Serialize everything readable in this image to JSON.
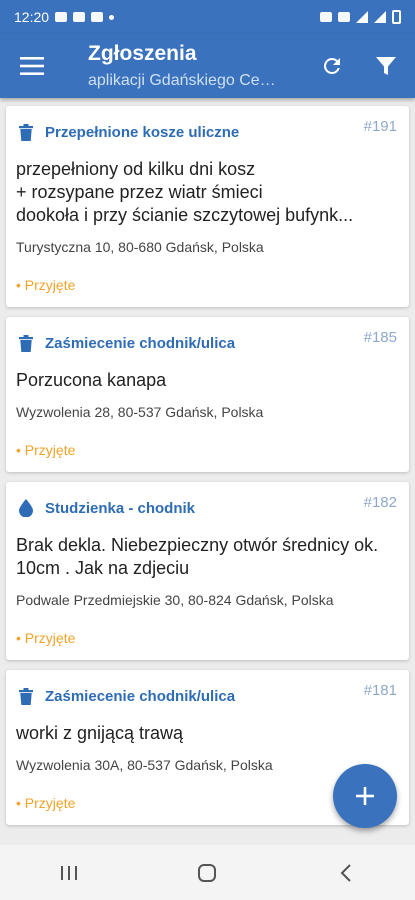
{
  "status_bar": {
    "time": "12:20"
  },
  "app_bar": {
    "title": "Zgłoszenia",
    "subtitle": "aplikacji Gdańskiego Centrum Kontaktu",
    "icons": {
      "menu": "menu-icon",
      "refresh": "refresh-icon",
      "filter": "filter-icon"
    }
  },
  "reports": [
    {
      "category": "Przepełnione kosze uliczne",
      "category_icon": "trash-icon",
      "number": "#191",
      "description": "przepełniony od  kilku dni kosz\n+ rozsypane przez wiatr śmieci\ndookoła i przy ścianie szczytowej bufynk...",
      "address": "Turystyczna 10, 80-680 Gdańsk, Polska",
      "status": "• Przyjęte"
    },
    {
      "category": "Zaśmiecenie chodnik/ulica",
      "category_icon": "trash-icon",
      "number": "#185",
      "description": "Porzucona kanapa",
      "address": "Wyzwolenia 28, 80-537 Gdańsk, Polska",
      "status": "• Przyjęte"
    },
    {
      "category": "Studzienka - chodnik",
      "category_icon": "water-drop-icon",
      "number": "#182",
      "description": "Brak dekla. Niebezpieczny otwór średnicy ok. 10cm . Jak na zdjeciu",
      "address": "Podwale Przedmiejskie 30, 80-824 Gdańsk, Polska",
      "status": "• Przyjęte"
    },
    {
      "category": "Zaśmiecenie chodnik/ulica",
      "category_icon": "trash-icon",
      "number": "#181",
      "description": "worki z gnijącą trawą",
      "address": "Wyzwolenia 30A, 80-537 Gdańsk, Polska",
      "status": "• Przyjęte"
    }
  ],
  "fab": {
    "icon": "plus-icon"
  },
  "colors": {
    "primary": "#3a72bd",
    "category_text": "#2e6cb5",
    "number_text": "#8fa9cc",
    "status_text": "#f1a329"
  }
}
